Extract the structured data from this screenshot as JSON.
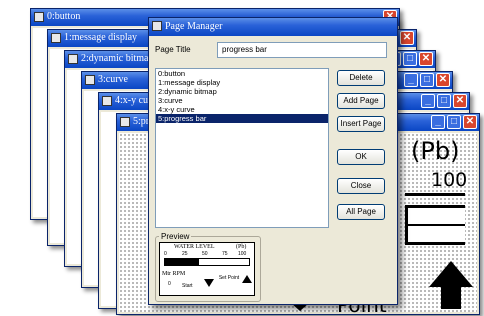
{
  "windows": [
    {
      "title": "0:button"
    },
    {
      "title": "1:message display"
    },
    {
      "title": "2:dynamic bitmap"
    },
    {
      "title": "3:curve"
    },
    {
      "title": "4:x-y curve"
    },
    {
      "title": "5:progress bar"
    }
  ],
  "page_manager": {
    "title": "Page Manager",
    "page_title_label": "Page Title",
    "page_title_value": "progress bar",
    "pages": [
      "0:button",
      "1:message display",
      "2:dynamic bitmap",
      "3:curve",
      "4:x-y curve",
      "5:progress bar"
    ],
    "selected_index": 5,
    "buttons": {
      "delete": "Delete",
      "add_page": "Add Page",
      "insert_page": "Insert Page",
      "ok": "OK",
      "close": "Close",
      "all_page": "All Page"
    },
    "preview": {
      "label": "Preview",
      "heading": "WATER LEVEL",
      "unit": "(Pb)",
      "ticks": [
        "0",
        "25",
        "50",
        "75",
        "100"
      ],
      "motor_rpm": "Mtr RPM",
      "rpm_value": "0",
      "start": "Start",
      "set_point": "Set Point"
    }
  },
  "background_page": {
    "unit": "(Pb)",
    "tick_100": "100",
    "bottom_text": "Point"
  }
}
